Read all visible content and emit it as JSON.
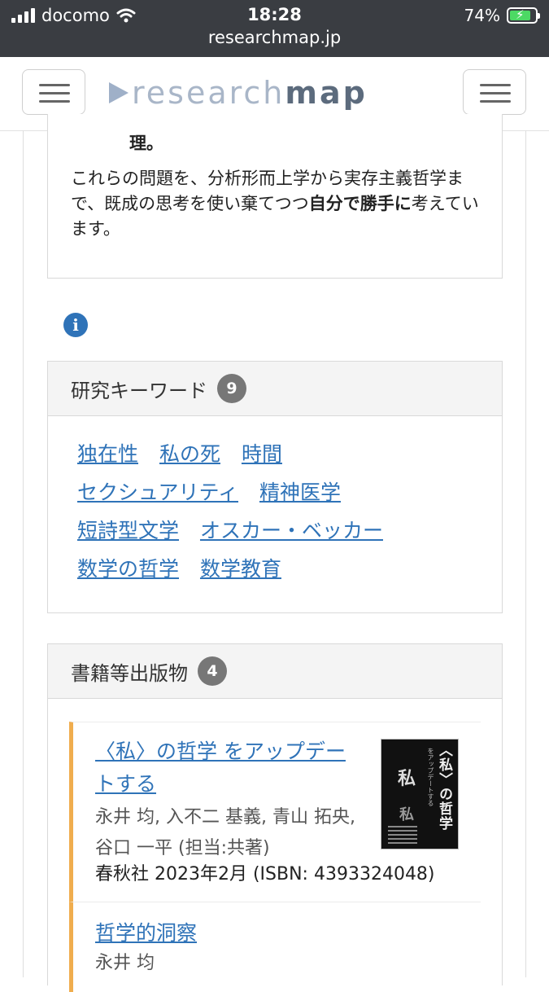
{
  "status_bar": {
    "carrier": "docomo",
    "time": "18:28",
    "battery": "74%",
    "url": "researchmap.jp"
  },
  "header": {
    "logo_research": "research",
    "logo_map": "map"
  },
  "intro": {
    "text_top": "理。",
    "para_before_bold": "これらの問題を、分析形而上学から実存主義哲学まで、既成の思考を使い棄てつつ",
    "para_bold": "自分で勝手に",
    "para_after_bold": "考えています。"
  },
  "info_icon": "i",
  "keywords": {
    "title": "研究キーワード",
    "count": "9",
    "items": [
      "独在性",
      "私の死",
      "時間",
      "セクシュアリティ",
      "精神医学",
      "短詩型文学",
      "オスカー・ベッカー",
      "数学の哲学",
      "数学教育"
    ]
  },
  "books": {
    "title": "書籍等出版物",
    "count": "4",
    "items": [
      {
        "title": "〈私〉の哲学 をアップデートする",
        "authors": "永井 均, 入不二 基義, 青山 拓央, 谷口 一平 (担当:共著)",
        "publisher": "春秋社 2023年2月 (ISBN: 4393324048)",
        "cover_title": "〈私〉の哲学",
        "cover_sub": "をアップデートする",
        "cover_big": "私",
        "cover_big2": "私"
      },
      {
        "title": "哲学的洞察",
        "authors": "永井 均"
      }
    ]
  }
}
